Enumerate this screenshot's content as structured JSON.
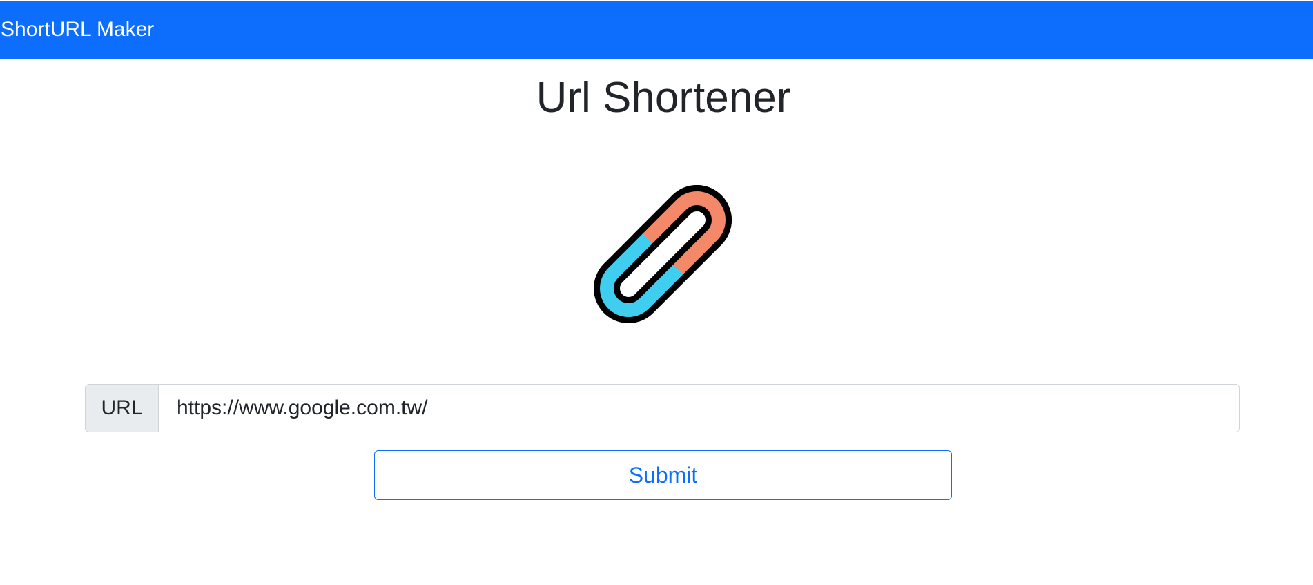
{
  "navbar": {
    "brand": "ShortURL Maker",
    "color": "#0d6efd"
  },
  "main": {
    "title": "Url Shortener",
    "logo_icon": "chain-link-icon",
    "logo_colors": {
      "link_left": "#3fcdf0",
      "link_right": "#f4896a",
      "outline": "#000000"
    },
    "url_field": {
      "label": "URL",
      "value": "https://www.google.com.tw/"
    },
    "submit_label": "Submit"
  }
}
